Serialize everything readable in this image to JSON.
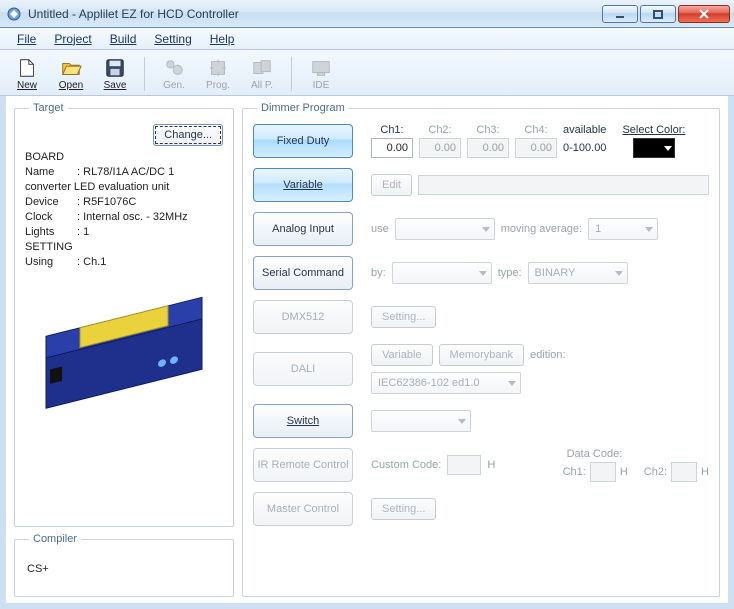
{
  "window": {
    "title": "Untitled - Applilet EZ for HCD Controller"
  },
  "menubar": {
    "file": "File",
    "project": "Project",
    "build": "Build",
    "setting": "Setting",
    "help": "Help"
  },
  "toolbar": {
    "new": "New",
    "open": "Open",
    "save": "Save",
    "gen": "Gen.",
    "prog": "Prog.",
    "allp": "All P.",
    "ide": "IDE"
  },
  "target": {
    "legend": "Target",
    "change": "Change...",
    "board_label": "BOARD",
    "name_k": "Name",
    "name_v": "RL78/I1A AC/DC 1",
    "name2": "converter LED evaluation unit",
    "device_k": "Device",
    "device_v": "R5F1076C",
    "clock_k": "Clock",
    "clock_v": "Internal osc. - 32MHz",
    "lights_k": "Lights",
    "lights_v": "1",
    "setting_label": "SETTING",
    "using_k": "Using",
    "using_v": "Ch.1"
  },
  "compiler": {
    "legend": "Compiler",
    "value": "CS+"
  },
  "dimmer": {
    "legend": "Dimmer Program",
    "rows": {
      "fixed": "Fixed Duty",
      "variable": "Variable",
      "analog": "Analog Input",
      "serial": "Serial Command",
      "dmx": "DMX512",
      "dali": "DALI",
      "switch": "Switch",
      "ir": "IR Remote Control",
      "master": "Master Control"
    },
    "ch1": "Ch1:",
    "ch2": "Ch2:",
    "ch3": "Ch3:",
    "ch4": "Ch4:",
    "ch1v": "0.00",
    "ch2v": "0.00",
    "ch3v": "0.00",
    "ch4v": "0.00",
    "available": "available",
    "range": "0-100.00",
    "selectcolor": "Select Color:",
    "edit": "Edit",
    "use": "use",
    "moving_avg": "moving average:",
    "mavg_v": "1",
    "by": "by:",
    "type": "type:",
    "type_v": "BINARY",
    "setting_btn": "Setting...",
    "dali_var": "Variable",
    "dali_mem": "Memorybank",
    "edition": "edition:",
    "edition_v": "IEC62386-102 ed1.0",
    "custom": "Custom Code:",
    "H": "H",
    "dcode": "Data Code:",
    "dch1": "Ch1:",
    "dch2": "Ch2:"
  }
}
